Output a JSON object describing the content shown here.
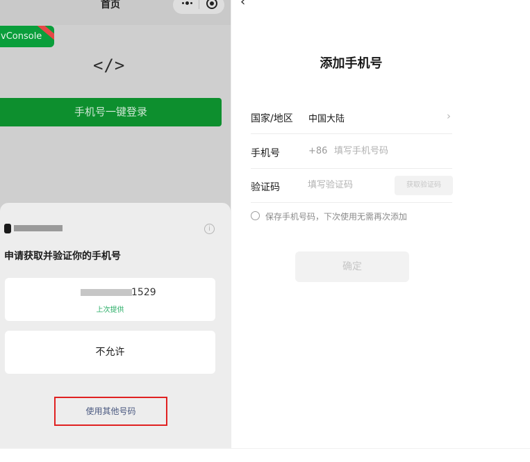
{
  "left_panel": {
    "nav_title": "首页",
    "vconsole_label": "vConsole",
    "code_icon_text": "</>",
    "login_button": "手机号一键登录",
    "sheet": {
      "title": "申请获取并验证你的手机号",
      "info_icon_glyph": "i",
      "phone_suffix": "1529",
      "phone_hint": "上次提供",
      "deny_label": "不允许",
      "other_number_label": "使用其他号码"
    }
  },
  "right_panel": {
    "back_icon_glyph": "‹",
    "title": "添加手机号",
    "region": {
      "label": "国家/地区",
      "value": "中国大陆",
      "chevron_glyph": "›"
    },
    "phone": {
      "label": "手机号",
      "prefix": "+86",
      "placeholder": "填写手机号码",
      "value": ""
    },
    "code": {
      "label": "验证码",
      "placeholder": "填写验证码",
      "value": "",
      "button": "获取验证码"
    },
    "save_text": "保存手机号码，下次使用无需再次添加",
    "confirm_label": "确定"
  },
  "colors": {
    "brand_green": "#0d8f2e",
    "hint_green": "#2aae67",
    "highlight_red": "#e02020",
    "link_blue": "#4a5980"
  },
  "icons": [
    "more-icon",
    "target-icon",
    "code-icon",
    "info-icon",
    "back-icon",
    "chevron-right-icon",
    "radio-icon"
  ]
}
